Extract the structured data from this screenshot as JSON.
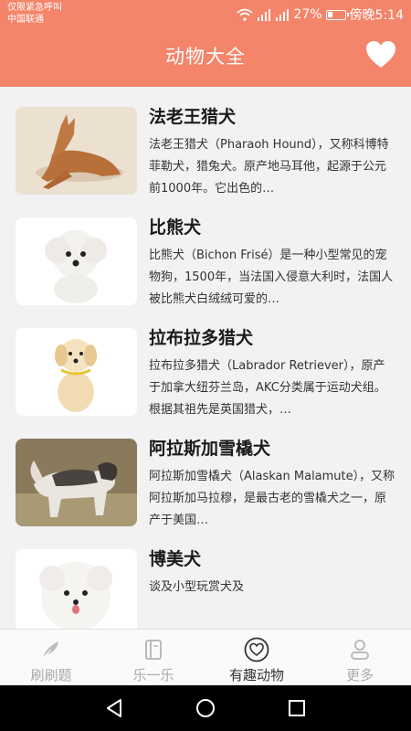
{
  "status": {
    "carrier_line1": "仅限紧急呼叫",
    "carrier_line2": "中国联通",
    "battery": "27%",
    "time": "傍晚5:14"
  },
  "appbar": {
    "title": "动物大全",
    "favorite_icon": "heart-icon"
  },
  "animals": [
    {
      "name": "法老王猎犬",
      "desc": "法老王猎犬（Pharaoh Hound），又称科博特菲勒犬，猎兔犬。原产地马耳他，起源于公元前1000年。它出色的…"
    },
    {
      "name": "比熊犬",
      "desc": "比熊犬（Bichon Frisé）是一种小型常见的宠物狗，1500年，当法国入侵意大利时，法国人被比熊犬白绒绒可爱的…"
    },
    {
      "name": "拉布拉多猎犬",
      "desc": "拉布拉多猎犬（Labrador Retriever），原产于加拿大纽芬兰岛，AKC分类属于运动犬组。根据其祖先是英国猎犬，…"
    },
    {
      "name": "阿拉斯加雪橇犬",
      "desc": "阿拉斯加雪橇犬（Alaskan Malamute），又称阿拉斯加马拉穆，是最古老的雪橇犬之一，原产于美国…"
    },
    {
      "name": "博美犬",
      "desc": "谈及小型玩赏犬及"
    }
  ],
  "tabs": [
    {
      "label": "刷刷题",
      "icon": "feather-icon"
    },
    {
      "label": "乐一乐",
      "icon": "book-icon"
    },
    {
      "label": "有趣动物",
      "icon": "heart-circle-icon"
    },
    {
      "label": "更多",
      "icon": "person-icon"
    }
  ],
  "colors": {
    "accent": "#f4846a"
  }
}
